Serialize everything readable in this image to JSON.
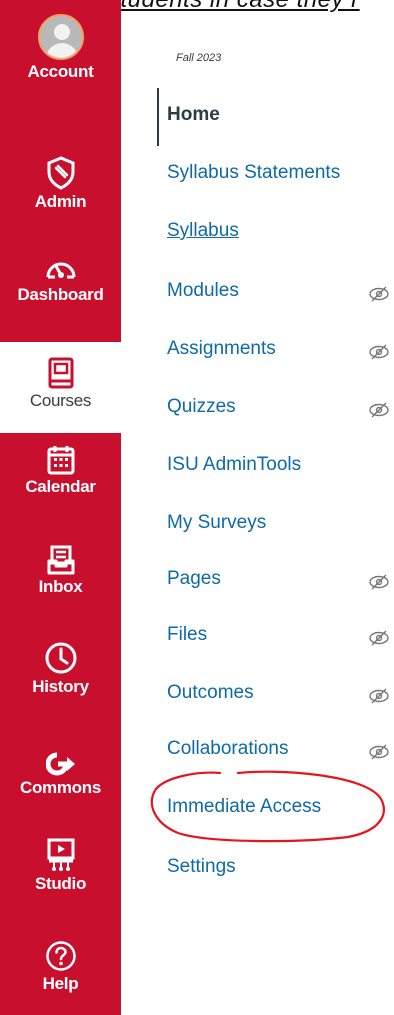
{
  "header_fragment": "students in case they r",
  "global_nav": {
    "account": "Account",
    "admin": "Admin",
    "dashboard": "Dashboard",
    "courses": "Courses",
    "calendar": "Calendar",
    "inbox": "Inbox",
    "history": "History",
    "commons": "Commons",
    "studio": "Studio",
    "help": "Help"
  },
  "course_nav": {
    "term": "Fall 2023",
    "items": [
      {
        "label": "Home",
        "hidden": false
      },
      {
        "label": "Syllabus Statements",
        "hidden": false
      },
      {
        "label": "Syllabus",
        "hidden": false
      },
      {
        "label": "Modules",
        "hidden": true
      },
      {
        "label": "Assignments",
        "hidden": true
      },
      {
        "label": "Quizzes",
        "hidden": true
      },
      {
        "label": "ISU AdminTools",
        "hidden": false
      },
      {
        "label": "My Surveys",
        "hidden": false
      },
      {
        "label": "Pages",
        "hidden": true
      },
      {
        "label": "Files",
        "hidden": true
      },
      {
        "label": "Outcomes",
        "hidden": true
      },
      {
        "label": "Collaborations",
        "hidden": true
      },
      {
        "label": "Immediate Access",
        "hidden": false
      },
      {
        "label": "Settings",
        "hidden": false
      }
    ]
  },
  "colors": {
    "brand": "#c8102e",
    "link": "#0e6aa6",
    "annotation": "#e8141c"
  }
}
